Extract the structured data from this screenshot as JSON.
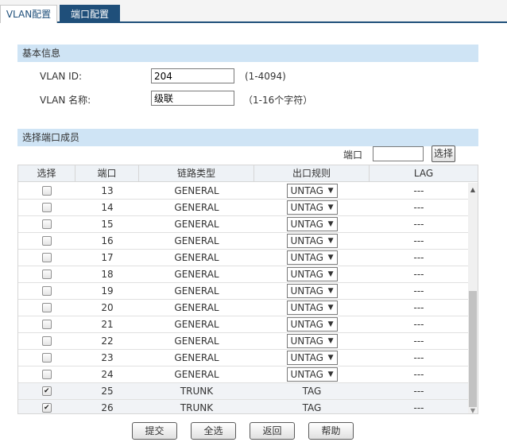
{
  "tabs": [
    {
      "label": "VLAN配置"
    },
    {
      "label": "端口配置"
    }
  ],
  "basic_info": {
    "header": "基本信息",
    "vlan_id_label": "VLAN ID:",
    "vlan_id_value": "204",
    "vlan_id_hint": "(1-4094)",
    "vlan_name_label": "VLAN 名称:",
    "vlan_name_value": "级联",
    "vlan_name_hint": "（1-16个字符）"
  },
  "members": {
    "header": "选择端口成员",
    "port_search_label": "端口",
    "port_search_value": "",
    "select_button": "选择",
    "columns": [
      "选择",
      "端口",
      "链路类型",
      "出口规则",
      "LAG"
    ],
    "rows": [
      {
        "checked": false,
        "port": "13",
        "link": "GENERAL",
        "rule": "UNTAG",
        "rule_select": true,
        "lag": "---"
      },
      {
        "checked": false,
        "port": "14",
        "link": "GENERAL",
        "rule": "UNTAG",
        "rule_select": true,
        "lag": "---"
      },
      {
        "checked": false,
        "port": "15",
        "link": "GENERAL",
        "rule": "UNTAG",
        "rule_select": true,
        "lag": "---"
      },
      {
        "checked": false,
        "port": "16",
        "link": "GENERAL",
        "rule": "UNTAG",
        "rule_select": true,
        "lag": "---"
      },
      {
        "checked": false,
        "port": "17",
        "link": "GENERAL",
        "rule": "UNTAG",
        "rule_select": true,
        "lag": "---"
      },
      {
        "checked": false,
        "port": "18",
        "link": "GENERAL",
        "rule": "UNTAG",
        "rule_select": true,
        "lag": "---"
      },
      {
        "checked": false,
        "port": "19",
        "link": "GENERAL",
        "rule": "UNTAG",
        "rule_select": true,
        "lag": "---"
      },
      {
        "checked": false,
        "port": "20",
        "link": "GENERAL",
        "rule": "UNTAG",
        "rule_select": true,
        "lag": "---"
      },
      {
        "checked": false,
        "port": "21",
        "link": "GENERAL",
        "rule": "UNTAG",
        "rule_select": true,
        "lag": "---"
      },
      {
        "checked": false,
        "port": "22",
        "link": "GENERAL",
        "rule": "UNTAG",
        "rule_select": true,
        "lag": "---"
      },
      {
        "checked": false,
        "port": "23",
        "link": "GENERAL",
        "rule": "UNTAG",
        "rule_select": true,
        "lag": "---"
      },
      {
        "checked": false,
        "port": "24",
        "link": "GENERAL",
        "rule": "UNTAG",
        "rule_select": true,
        "lag": "---"
      },
      {
        "checked": true,
        "port": "25",
        "link": "TRUNK",
        "rule": "TAG",
        "rule_select": false,
        "lag": "---"
      },
      {
        "checked": true,
        "port": "26",
        "link": "TRUNK",
        "rule": "TAG",
        "rule_select": false,
        "lag": "---"
      }
    ]
  },
  "buttons": {
    "submit": "提交",
    "select_all": "全选",
    "back": "返回",
    "help": "帮助"
  },
  "colors": {
    "tab_active_bg": "#ffffff",
    "tab_inactive_bg": "#1f4f7a",
    "section_header_bg": "#cfe4f5",
    "table_header_bg": "#eef2f6"
  }
}
